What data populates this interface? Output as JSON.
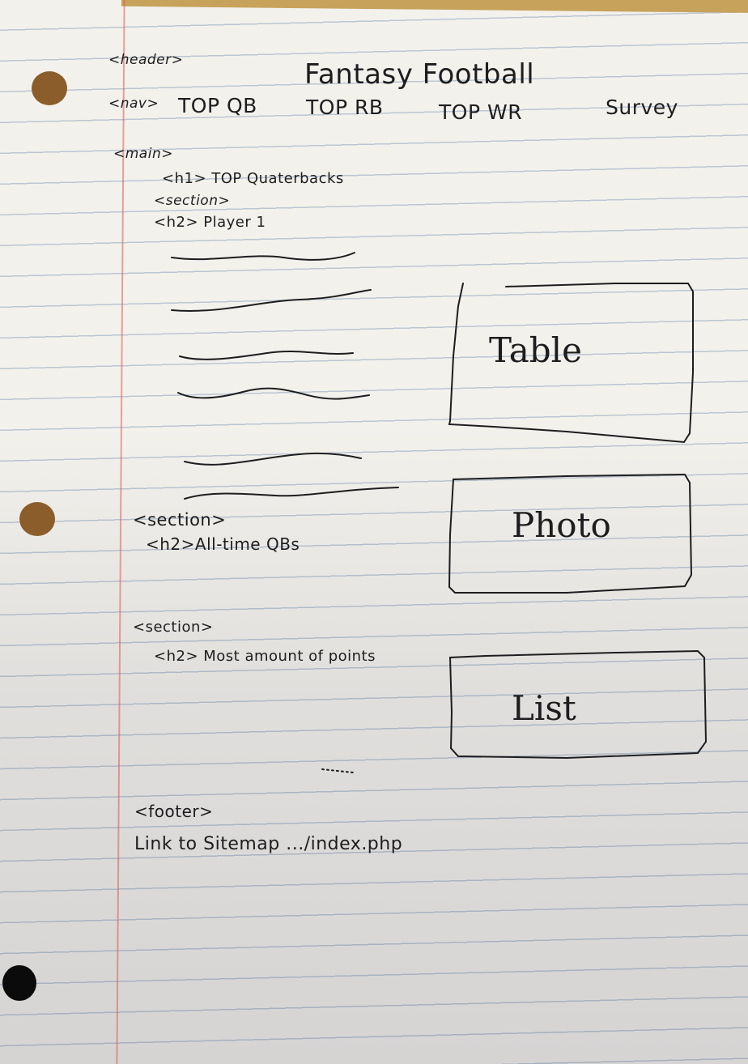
{
  "header": {
    "tag": "<header>",
    "title": "Fantasy Football"
  },
  "nav": {
    "tag": "<nav>",
    "items": [
      "TOP QB",
      "TOP RB",
      "TOP WR",
      "Survey"
    ]
  },
  "main": {
    "tag": "<main>",
    "h1": "<h1> TOP Quaterbacks",
    "section1": {
      "tag": "<section>",
      "h2": "<h2> Player 1"
    },
    "section2": {
      "tag": "<section>",
      "h2": "<h2>All-time QBs"
    },
    "section3": {
      "tag": "<section>",
      "h2": "<h2> Most amount of points"
    }
  },
  "boxes": [
    "Table",
    "Photo",
    "List"
  ],
  "footer": {
    "tag": "<footer>",
    "text": "Link to Sitemap .../index.php"
  }
}
